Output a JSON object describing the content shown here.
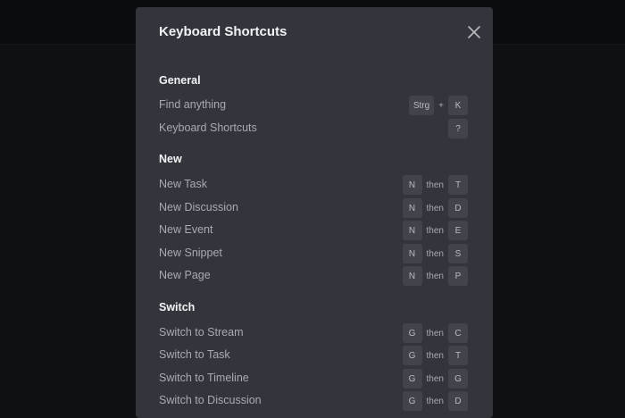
{
  "modal": {
    "title": "Keyboard Shortcuts",
    "close_icon": "close-icon"
  },
  "sections": {
    "general": {
      "title": "General",
      "rows": [
        {
          "label": "Find anything",
          "key1": "Strg",
          "sep": "+",
          "key2": "K"
        },
        {
          "label": "Keyboard Shortcuts",
          "key1": "?"
        }
      ]
    },
    "new": {
      "title": "New",
      "rows": [
        {
          "label": "New Task",
          "key1": "N",
          "sep": "then",
          "key2": "T"
        },
        {
          "label": "New Discussion",
          "key1": "N",
          "sep": "then",
          "key2": "D"
        },
        {
          "label": "New Event",
          "key1": "N",
          "sep": "then",
          "key2": "E"
        },
        {
          "label": "New Snippet",
          "key1": "N",
          "sep": "then",
          "key2": "S"
        },
        {
          "label": "New Page",
          "key1": "N",
          "sep": "then",
          "key2": "P"
        }
      ]
    },
    "switch": {
      "title": "Switch",
      "rows": [
        {
          "label": "Switch to Stream",
          "key1": "G",
          "sep": "then",
          "key2": "C"
        },
        {
          "label": "Switch to Task",
          "key1": "G",
          "sep": "then",
          "key2": "T"
        },
        {
          "label": "Switch to Timeline",
          "key1": "G",
          "sep": "then",
          "key2": "G"
        },
        {
          "label": "Switch to Discussion",
          "key1": "G",
          "sep": "then",
          "key2": "D"
        }
      ]
    }
  }
}
